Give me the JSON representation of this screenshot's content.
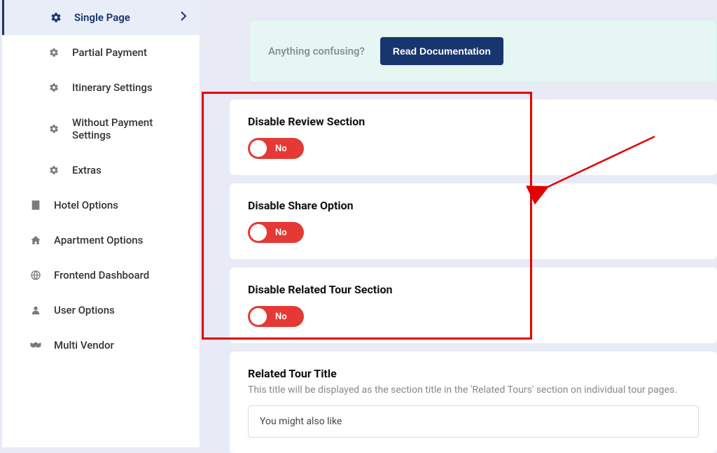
{
  "sidebar": {
    "items": [
      {
        "label": "Single Page",
        "icon": "gear",
        "active": true,
        "sub": true
      },
      {
        "label": "Partial Payment",
        "icon": "gear",
        "sub": true
      },
      {
        "label": "Itinerary Settings",
        "icon": "gear",
        "sub": true
      },
      {
        "label": "Without Payment Settings",
        "icon": "gear",
        "sub": true
      },
      {
        "label": "Extras",
        "icon": "gear",
        "sub": true
      },
      {
        "label": "Hotel Options",
        "icon": "building"
      },
      {
        "label": "Apartment Options",
        "icon": "home"
      },
      {
        "label": "Frontend Dashboard",
        "icon": "globe"
      },
      {
        "label": "User Options",
        "icon": "user"
      },
      {
        "label": "Multi Vendor",
        "icon": "handshake"
      }
    ]
  },
  "callout": {
    "ask": "Anything confusing?",
    "button": "Read Documentation"
  },
  "cards": {
    "disable_review": {
      "title": "Disable Review Section",
      "toggle": "No"
    },
    "disable_share": {
      "title": "Disable Share Option",
      "toggle": "No"
    },
    "disable_related": {
      "title": "Disable Related Tour Section",
      "toggle": "No"
    },
    "related_title": {
      "title": "Related Tour Title",
      "desc": "This title will be displayed as the section title in the 'Related Tours' section on individual tour pages.",
      "value": "You might also like"
    }
  },
  "colors": {
    "accent": "#17366f",
    "toggle_off": "#e53935",
    "annotation": "#e30000"
  }
}
